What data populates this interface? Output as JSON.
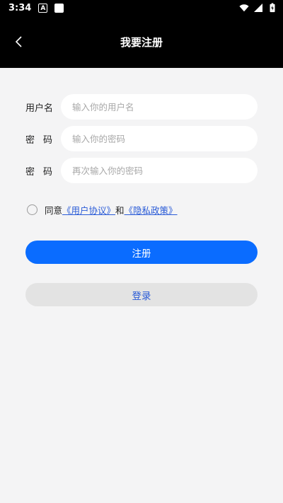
{
  "status_bar": {
    "time": "3:34",
    "app_icon_letter": "A"
  },
  "header": {
    "title": "我要注册"
  },
  "form": {
    "username_label": "用户名",
    "username_placeholder": "输入你的用户名",
    "password_label": "密码",
    "password_placeholder": "输入你的密码",
    "confirm_label": "密码",
    "confirm_placeholder": "再次输入你的密码"
  },
  "agreement": {
    "prefix": "同意",
    "user_agreement": "《用户协议》",
    "and": "和",
    "privacy_policy": "《隐私政策》"
  },
  "buttons": {
    "register": "注册",
    "login": "登录"
  },
  "colors": {
    "primary": "#0a6cff",
    "link": "#2a5bd7",
    "background": "#f4f4f5"
  }
}
